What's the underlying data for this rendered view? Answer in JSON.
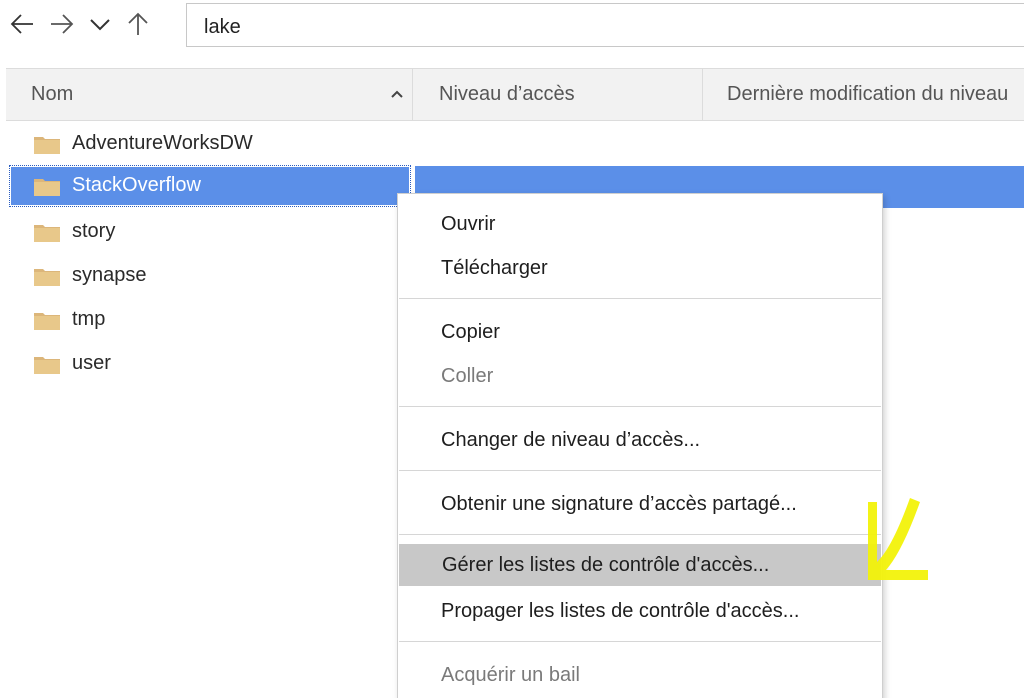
{
  "nav": {
    "back_icon": "arrow-left-icon",
    "forward_icon": "arrow-right-icon",
    "dropdown_icon": "chevron-down-icon",
    "up_icon": "arrow-up-icon"
  },
  "address": {
    "value": "lake"
  },
  "columns": {
    "nom": "Nom",
    "niveau": "Niveau d’accès",
    "derniere": "Dernière modification du niveau"
  },
  "files": [
    {
      "label": "AdventureWorksDW",
      "selected": false
    },
    {
      "label": "StackOverflow",
      "selected": true
    },
    {
      "label": "story",
      "selected": false
    },
    {
      "label": "synapse",
      "selected": false
    },
    {
      "label": "tmp",
      "selected": false
    },
    {
      "label": "user",
      "selected": false
    }
  ],
  "menu": {
    "items": [
      {
        "label": "Ouvrir",
        "state": "normal"
      },
      {
        "label": "Télécharger",
        "state": "normal"
      },
      {
        "label": "Copier",
        "state": "normal"
      },
      {
        "label": "Coller",
        "state": "disabled"
      },
      {
        "label": "Changer de niveau d’accès...",
        "state": "normal"
      },
      {
        "label": "Obtenir une signature d’accès partagé...",
        "state": "normal"
      },
      {
        "label": "Gérer les listes de contrôle d'accès...",
        "state": "hover"
      },
      {
        "label": "Propager les listes de contrôle d'accès...",
        "state": "normal"
      },
      {
        "label": "Acquérir un bail",
        "state": "disabled"
      }
    ]
  },
  "colors": {
    "selection": "#5b8fe8",
    "menu_hover": "#c8c8c8",
    "folder": "#dcb67a",
    "annotation": "#f2f20a"
  }
}
